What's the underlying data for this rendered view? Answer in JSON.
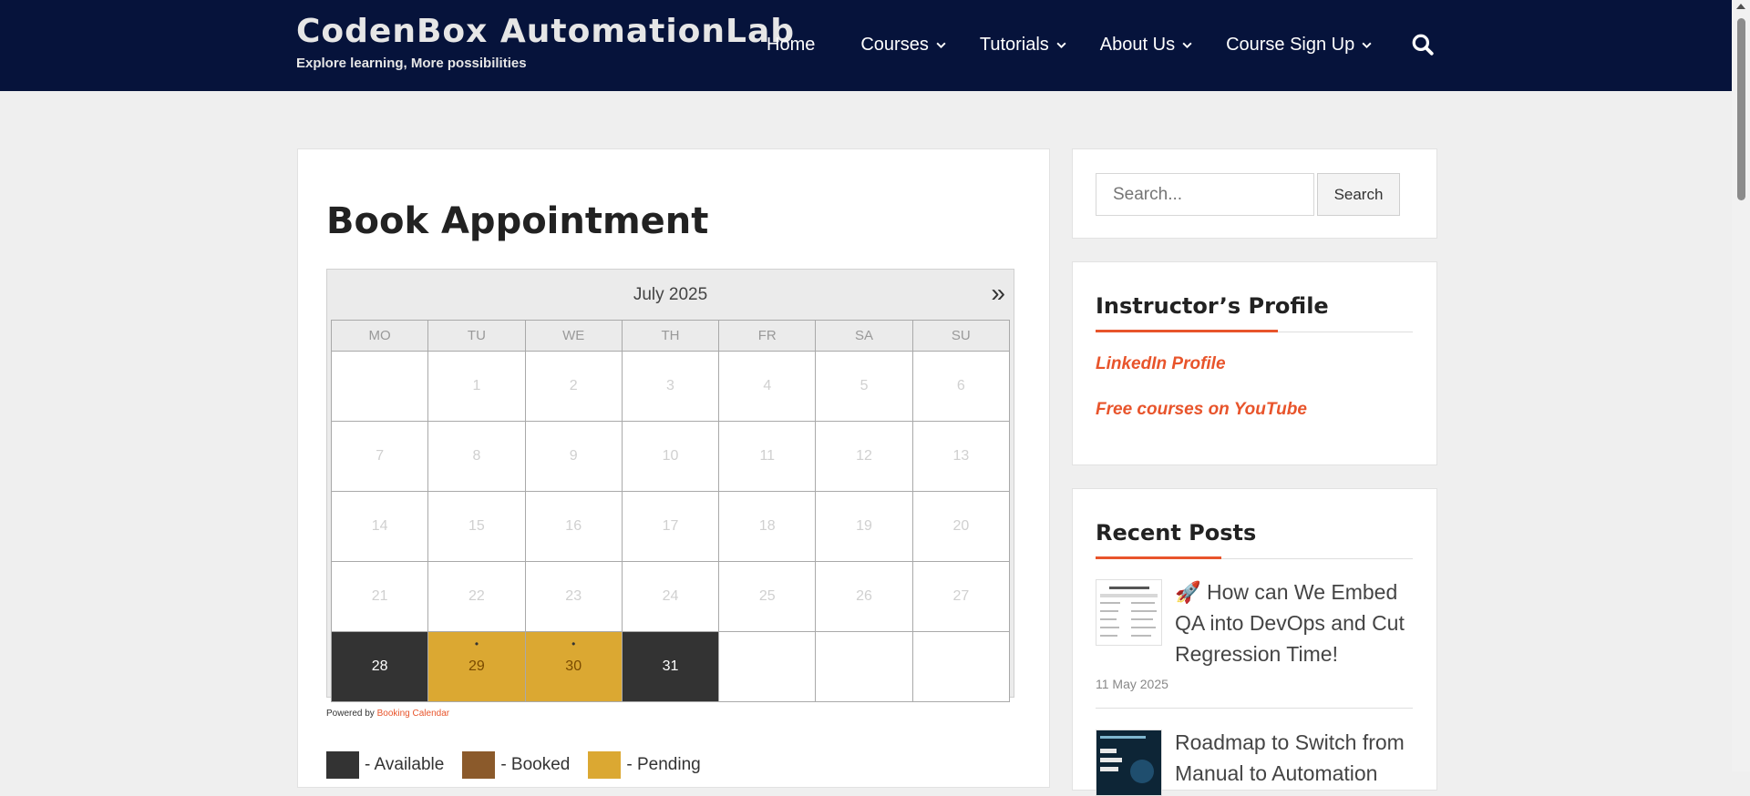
{
  "header": {
    "site_title": "CodenBox AutomationLab",
    "tagline": "Explore learning, More possibilities",
    "nav": [
      {
        "label": "Home",
        "has_dropdown": false
      },
      {
        "label": "Courses",
        "has_dropdown": true
      },
      {
        "label": "Tutorials",
        "has_dropdown": true
      },
      {
        "label": "About Us",
        "has_dropdown": true
      },
      {
        "label": "Course Sign Up",
        "has_dropdown": true
      }
    ],
    "search_icon": "search-icon",
    "background": "#06133b"
  },
  "main": {
    "title": "Book Appointment",
    "calendar": {
      "month": "July 2025",
      "next_icon": "double-chevron-right-icon",
      "weekdays": [
        "MO",
        "TU",
        "WE",
        "TH",
        "FR",
        "SA",
        "SU"
      ],
      "weeks": [
        [
          "",
          "1",
          "2",
          "3",
          "4",
          "5",
          "6"
        ],
        [
          "7",
          "8",
          "9",
          "10",
          "11",
          "12",
          "13"
        ],
        [
          "14",
          "15",
          "16",
          "17",
          "18",
          "19",
          "20"
        ],
        [
          "21",
          "22",
          "23",
          "24",
          "25",
          "26",
          "27"
        ],
        [
          "28",
          "29",
          "30",
          "31",
          "",
          "",
          ""
        ]
      ],
      "day_status": {
        "28": "available",
        "29": "pending",
        "30": "pending",
        "31": "available"
      }
    },
    "powered_by_prefix": "Powered by",
    "powered_by_link": "Booking Calendar",
    "legend": [
      {
        "label": "- Available",
        "color": "#333333"
      },
      {
        "label": "- Booked",
        "color": "#8b5a2b"
      },
      {
        "label": "- Pending",
        "color": "#dba832"
      }
    ]
  },
  "sidebar": {
    "search": {
      "placeholder": "Search...",
      "button_label": "Search"
    },
    "profile": {
      "title": "Instructor’s Profile",
      "links": [
        "LinkedIn Profile",
        "Free courses on YouTube"
      ]
    },
    "recent_posts": {
      "title": "Recent Posts",
      "posts": [
        {
          "title": "🚀 How can We Embed QA into DevOps and Cut Regression Time!",
          "date": "11 May 2025"
        },
        {
          "title": "Roadmap to Switch from Manual to Automation",
          "date": ""
        }
      ]
    }
  },
  "colors": {
    "accent": "#e8542b",
    "pending": "#dba832",
    "available": "#333333"
  }
}
